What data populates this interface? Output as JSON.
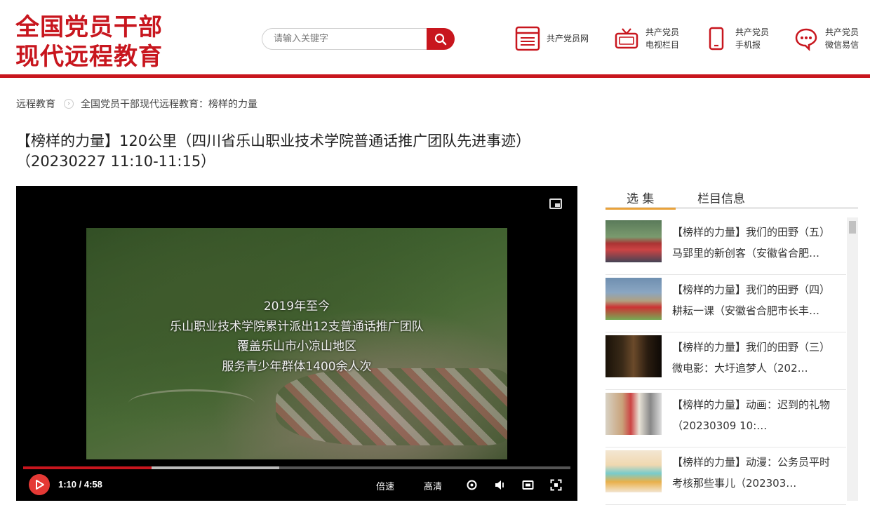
{
  "header": {
    "logo_line1": "全国党员干部",
    "logo_line2": "现代远程教育",
    "search_placeholder": "请输入关键字",
    "nav": [
      {
        "icon": "website-icon",
        "label1": "共产党员网",
        "label2": ""
      },
      {
        "icon": "tv-icon",
        "label1": "共产党员",
        "label2": "电视栏目"
      },
      {
        "icon": "phone-icon",
        "label1": "共产党员",
        "label2": "手机报"
      },
      {
        "icon": "chat-icon",
        "label1": "共产党员",
        "label2": "微信易信"
      }
    ],
    "accent_color": "#c8161e"
  },
  "breadcrumb": {
    "home": "远程教育",
    "current": "全国党员干部现代远程教育：榜样的力量"
  },
  "page_title": {
    "line1": "【榜样的力量】120公里（四川省乐山职业技术学院普通话推广团队先进事迹）",
    "line2": "（20230227 11:10-11:15）"
  },
  "player": {
    "subtitles": [
      "2019年至今",
      "乐山职业技术学院累计派出12支普通话推广团队",
      "覆盖乐山市小凉山地区",
      "服务青少年群体1400余人次"
    ],
    "time": "1:10 / 4:58",
    "progress_fraction": 0.235,
    "buffered_fraction": 0.468,
    "speed_label": "倍速",
    "quality_label": "高清"
  },
  "sidebar": {
    "tabs": [
      "选 集",
      "栏目信息"
    ],
    "active_tab": 0,
    "items": [
      {
        "line1": "【榜样的力量】我们的田野（五）",
        "line2": "马郢里的新创客（安徽省合肥…"
      },
      {
        "line1": "【榜样的力量】我们的田野（四）",
        "line2": "耕耘一课（安徽省合肥市长丰…"
      },
      {
        "line1": "【榜样的力量】我们的田野（三）",
        "line2": "微电影：大圩追梦人（202…"
      },
      {
        "line1": "【榜样的力量】动画：迟到的礼物",
        "line2": "（20230309 10:…"
      },
      {
        "line1": "【榜样的力量】动漫：公务员平时",
        "line2": "考核那些事儿（202303…"
      }
    ]
  }
}
